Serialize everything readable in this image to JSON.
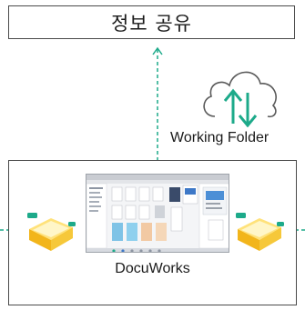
{
  "top_box": {
    "label": "정보 공유"
  },
  "cloud": {
    "label": "Working Folder",
    "icon": "cloud-sync-icon",
    "arrow_color": "#1daa8a"
  },
  "bottom_box": {
    "label": "DocuWorks",
    "screenshot": "docuworks-app-screenshot-icon"
  },
  "trays": {
    "left": "inbox-tray-icon",
    "right": "inbox-tray-icon"
  },
  "colors": {
    "connector": "#1daa8a",
    "tray_yellow": "#f2c21b",
    "tray_tab": "#1daa8a",
    "border": "#4a4a4a"
  }
}
